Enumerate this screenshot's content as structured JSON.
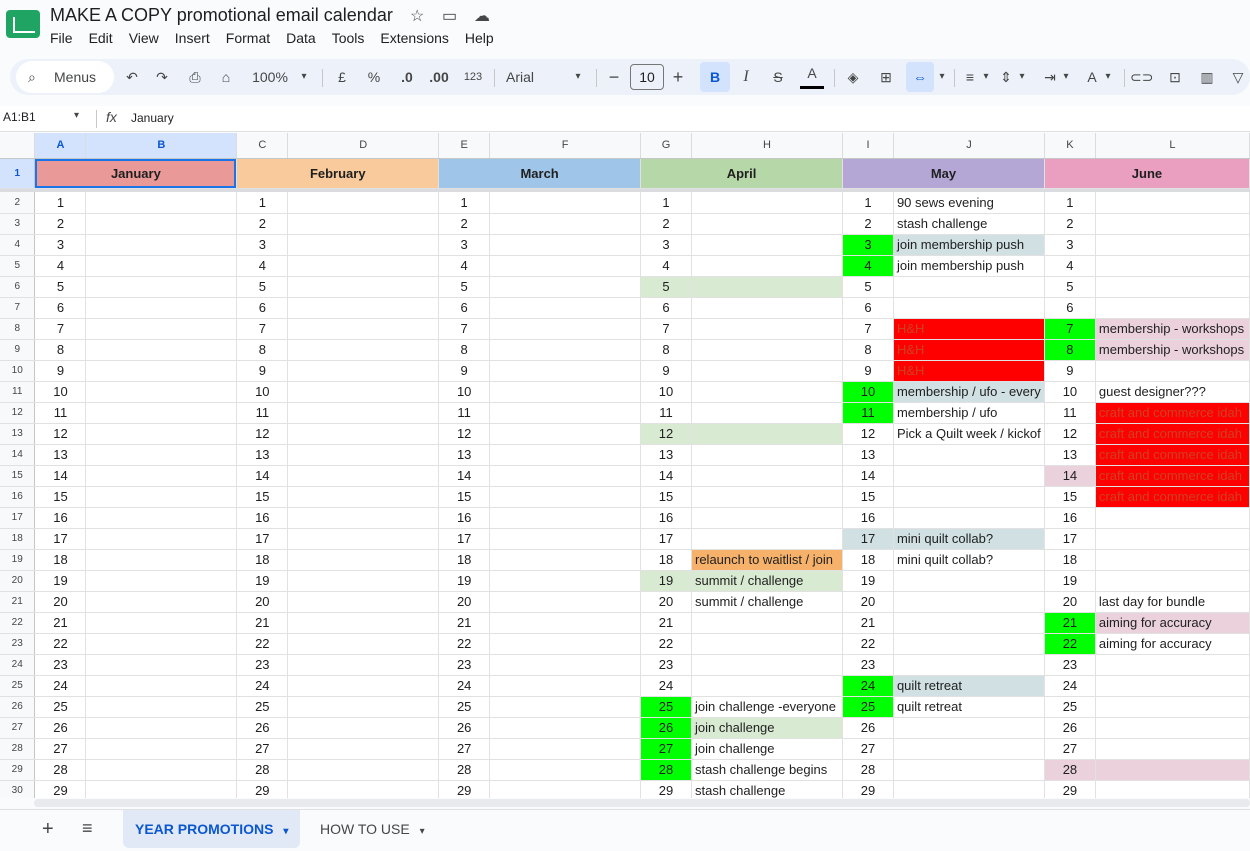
{
  "title": "MAKE A COPY promotional email calendar",
  "menu": [
    "File",
    "Edit",
    "View",
    "Insert",
    "Format",
    "Data",
    "Tools",
    "Extensions",
    "Help"
  ],
  "toolbar": {
    "menus_label": "Menus",
    "zoom": "100%",
    "currency": "£",
    "percent": "%",
    "dec_decrease": ".0",
    "dec_increase": ".00",
    "number_format": "123",
    "font": "Arial",
    "font_size": "10",
    "bold": "B",
    "italic": "I",
    "strike": "S",
    "text_color": "A"
  },
  "formula_bar": {
    "cell_ref": "A1:B1",
    "content": "January"
  },
  "columns": [
    "A",
    "B",
    "C",
    "D",
    "E",
    "F",
    "G",
    "H",
    "I",
    "J",
    "K",
    "L"
  ],
  "months": [
    {
      "name": "January",
      "color": "#ea9999"
    },
    {
      "name": "February",
      "color": "#f9cb9c"
    },
    {
      "name": "March",
      "color": "#9fc5e8"
    },
    {
      "name": "April",
      "color": "#b6d7a8"
    },
    {
      "name": "May",
      "color": "#b4a7d6"
    },
    {
      "name": "June",
      "color": "#ea9fc0"
    }
  ],
  "colors": {
    "green": "#00ff00",
    "red": "#ff0000",
    "light_green": "#d9ead3",
    "light_blue": "#d0e0e3",
    "orange": "#f6b26b",
    "pink": "#ead1dc",
    "red_text": "#cc4125"
  },
  "rows": [
    {
      "row": "2",
      "day": "1",
      "apr": "",
      "may": "90 sews evening",
      "jun": ""
    },
    {
      "row": "3",
      "day": "2",
      "apr": "",
      "may": "stash challenge",
      "jun": ""
    },
    {
      "row": "4",
      "day": "3",
      "apr": "",
      "may": "join membership push",
      "jun": ""
    },
    {
      "row": "5",
      "day": "4",
      "apr": "",
      "may": "join membership push",
      "jun": ""
    },
    {
      "row": "6",
      "day": "5",
      "apr": "",
      "may": "",
      "jun": ""
    },
    {
      "row": "7",
      "day": "6",
      "apr": "",
      "may": "",
      "jun": ""
    },
    {
      "row": "8",
      "day": "7",
      "apr": "",
      "may": "H&H",
      "jun": "membership - workshops"
    },
    {
      "row": "9",
      "day": "8",
      "apr": "",
      "may": "H&H",
      "jun": "membership - workshops"
    },
    {
      "row": "10",
      "day": "9",
      "apr": "",
      "may": "H&H",
      "jun": ""
    },
    {
      "row": "11",
      "day": "10",
      "apr": "",
      "may": "membership / ufo - every",
      "jun": "guest designer???"
    },
    {
      "row": "12",
      "day": "11",
      "apr": "",
      "may": "membership / ufo",
      "jun": "craft and commerce idah"
    },
    {
      "row": "13",
      "day": "12",
      "apr": "",
      "may": "Pick a Quilt week / kickof",
      "jun": "craft and commerce idah"
    },
    {
      "row": "14",
      "day": "13",
      "apr": "",
      "may": "",
      "jun": "craft and commerce idah"
    },
    {
      "row": "15",
      "day": "14",
      "apr": "",
      "may": "",
      "jun": "craft and commerce idah"
    },
    {
      "row": "16",
      "day": "15",
      "apr": "",
      "may": "",
      "jun": "craft and commerce idah"
    },
    {
      "row": "17",
      "day": "16",
      "apr": "",
      "may": "",
      "jun": ""
    },
    {
      "row": "18",
      "day": "17",
      "apr": "",
      "may": "mini quilt collab?",
      "jun": ""
    },
    {
      "row": "19",
      "day": "18",
      "apr": "relaunch to waitlist / join",
      "may": "mini quilt collab?",
      "jun": ""
    },
    {
      "row": "20",
      "day": "19",
      "apr": "summit / challenge",
      "may": "",
      "jun": ""
    },
    {
      "row": "21",
      "day": "20",
      "apr": "summit / challenge",
      "may": "",
      "jun": "last day for bundle"
    },
    {
      "row": "22",
      "day": "21",
      "apr": "",
      "may": "",
      "jun": "aiming for accuracy"
    },
    {
      "row": "23",
      "day": "22",
      "apr": "",
      "may": "",
      "jun": "aiming for accuracy"
    },
    {
      "row": "24",
      "day": "23",
      "apr": "",
      "may": "",
      "jun": ""
    },
    {
      "row": "25",
      "day": "24",
      "apr": "",
      "may": "quilt retreat",
      "jun": ""
    },
    {
      "row": "26",
      "day": "25",
      "apr": "join challenge -everyone",
      "may": "quilt retreat",
      "jun": ""
    },
    {
      "row": "27",
      "day": "26",
      "apr": "join challenge",
      "may": "",
      "jun": ""
    },
    {
      "row": "28",
      "day": "27",
      "apr": "join challenge",
      "may": "",
      "jun": ""
    },
    {
      "row": "29",
      "day": "28",
      "apr": "stash challenge begins",
      "may": "",
      "jun": ""
    },
    {
      "row": "30",
      "day": "29",
      "apr": "stash challenge",
      "may": "",
      "jun": ""
    }
  ],
  "sheets": [
    "YEAR PROMOTIONS",
    "HOW TO USE"
  ]
}
